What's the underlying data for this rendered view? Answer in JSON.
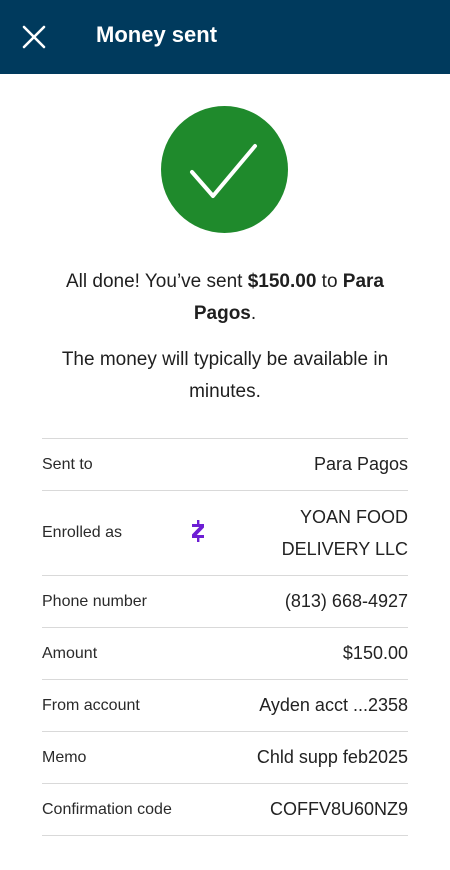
{
  "header": {
    "title": "Money sent"
  },
  "confirmation": {
    "prefix": "All done! You’ve sent ",
    "amount": "$150.00",
    "middle": " to ",
    "recipient": "Para Pagos",
    "suffix": ".",
    "availability": "The money will typically be available in minutes."
  },
  "details": {
    "sent_to": {
      "label": "Sent to",
      "value": "Para Pagos"
    },
    "enrolled_as": {
      "label": "Enrolled as",
      "value": "YOAN FOOD DELIVERY LLC",
      "icon": "zelle-icon"
    },
    "phone": {
      "label": "Phone number",
      "value": "(813) 668-4927"
    },
    "amount": {
      "label": "Amount",
      "value": "$150.00"
    },
    "from_account": {
      "label": "From account",
      "value": "Ayden acct ...2358"
    },
    "memo": {
      "label": "Memo",
      "value": "Chld supp feb2025"
    },
    "confirmation_code": {
      "label": "Confirmation code",
      "value": "COFFV8U60NZ9"
    }
  },
  "colors": {
    "header_bg": "#003a5d",
    "success_green": "#1f8a2c",
    "zelle_purple": "#6d1ed4"
  }
}
